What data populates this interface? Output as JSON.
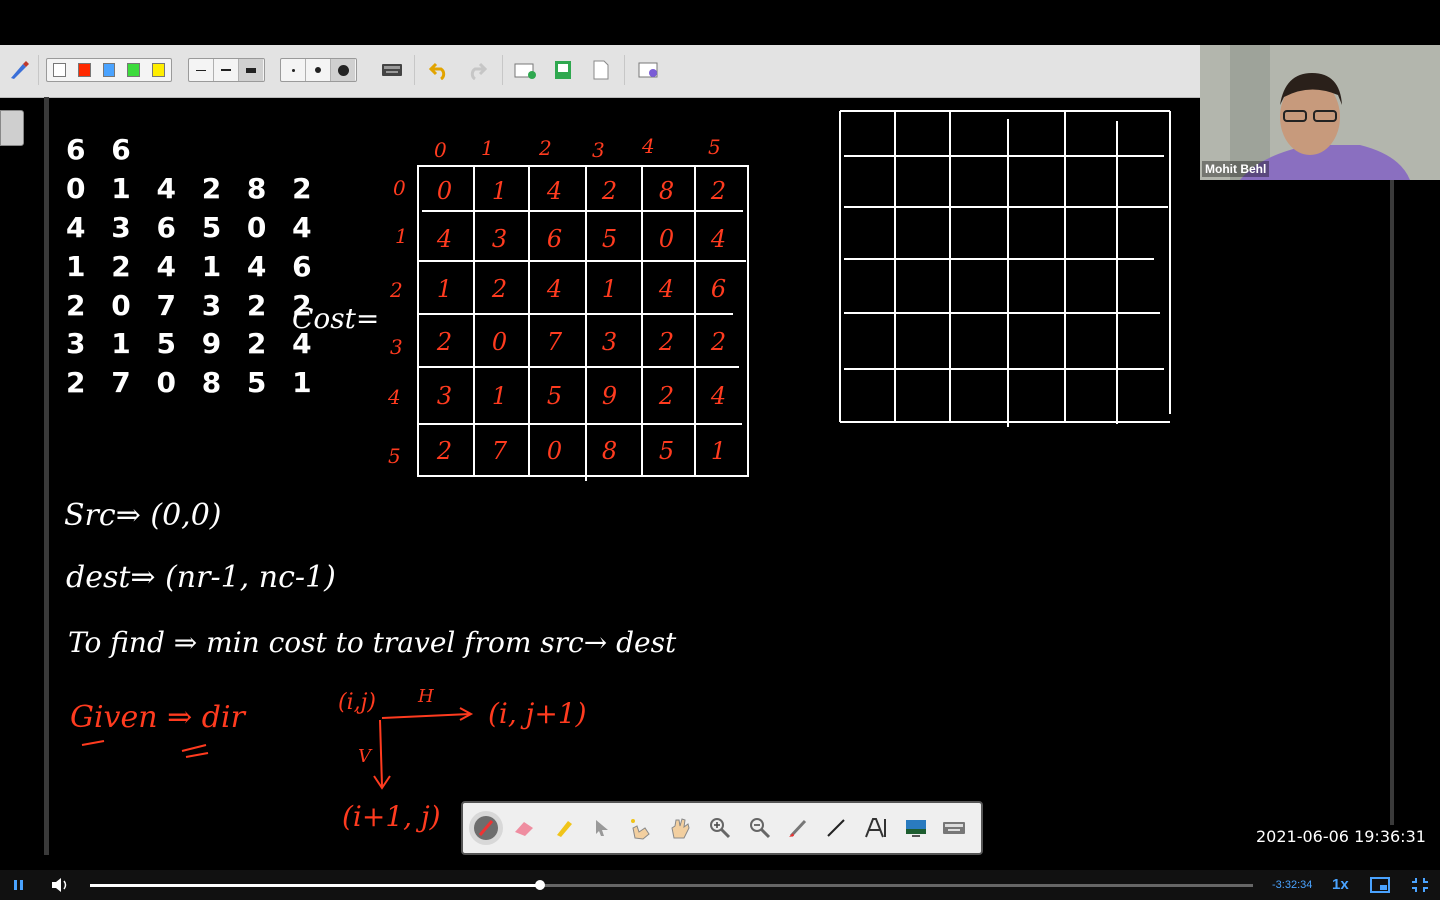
{
  "toolbar": {
    "colors": [
      "#ffffff",
      "#ff2a00",
      "#4aa3ff",
      "#3cdb3c",
      "#ffee00"
    ],
    "stroke_widths": [
      "thin",
      "medium",
      "thick"
    ],
    "dot_sizes": [
      "small",
      "medium",
      "large"
    ],
    "icons": [
      "pen-select-icon",
      "keyboard-icon",
      "undo-icon",
      "redo-icon",
      "add-page-icon",
      "save-page-icon",
      "page-icon",
      "settings-icon"
    ]
  },
  "board": {
    "input_header": "6 6",
    "input_rows": [
      "0 1 4 2 8 2",
      "4 3 6 5 0 4",
      "1 2 4 1 4 6",
      "2 0 7 3 2 2",
      "3 1 5 9 2 4",
      "2 7 0 8 5 1"
    ],
    "cost_label": "Cost=",
    "col_headers": [
      "0",
      "1",
      "2",
      "3",
      "4",
      "5"
    ],
    "row_headers": [
      "0",
      "1",
      "2",
      "3",
      "4",
      "5"
    ],
    "cost_grid": [
      [
        "0",
        "1",
        "4",
        "2",
        "8",
        "2"
      ],
      [
        "4",
        "3",
        "6",
        "5",
        "0",
        "4"
      ],
      [
        "1",
        "2",
        "4",
        "1",
        "4",
        "6"
      ],
      [
        "2",
        "0",
        "7",
        "3",
        "2",
        "2"
      ],
      [
        "3",
        "1",
        "5",
        "9",
        "2",
        "4"
      ],
      [
        "2",
        "7",
        "0",
        "8",
        "5",
        "1"
      ]
    ],
    "src_note": "Src⇒ (0,0)",
    "dest_note": "dest⇒ (nr-1, nc-1)",
    "find_note": "To find ⇒  min cost  to travel  from  src→ dest",
    "given_note": "Given ⇒  dir",
    "node_ij": "(i,j)",
    "h_label": "H",
    "node_right": "(i, j+1)",
    "v_label": "V",
    "node_down": "(i+1, j)"
  },
  "webcam": {
    "name": "Mohit Behl"
  },
  "draw_tools": [
    "pen-icon",
    "eraser-icon",
    "highlighter-icon",
    "pointer-icon",
    "magic-hand-icon",
    "hand-icon",
    "zoom-in-icon",
    "zoom-out-icon",
    "brush-icon",
    "line-icon",
    "text-icon",
    "screen-icon",
    "keyboard-icon"
  ],
  "timestamp": "2021-06-06  19:36:31",
  "player": {
    "remaining": "-3:32:34",
    "speed": "1x",
    "progress": 0.387
  },
  "colors": {
    "ink_red": "#ff3b1f",
    "ink_white": "#ffffff"
  }
}
